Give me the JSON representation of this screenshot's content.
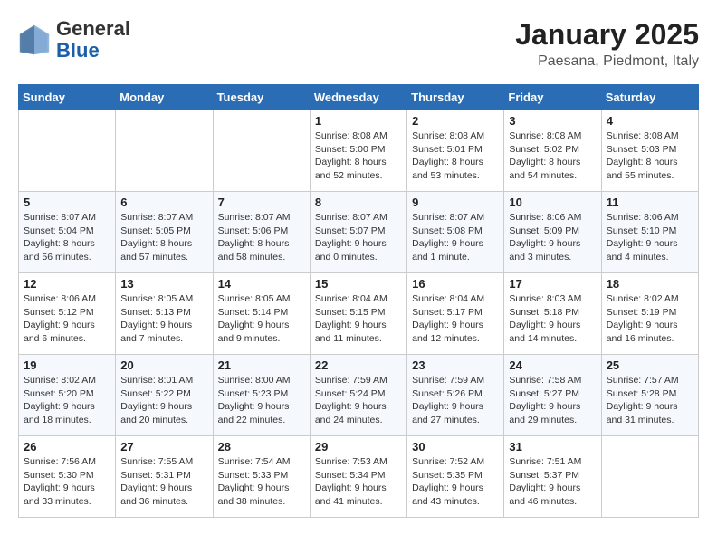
{
  "header": {
    "logo_general": "General",
    "logo_blue": "Blue",
    "month_year": "January 2025",
    "location": "Paesana, Piedmont, Italy"
  },
  "weekdays": [
    "Sunday",
    "Monday",
    "Tuesday",
    "Wednesday",
    "Thursday",
    "Friday",
    "Saturday"
  ],
  "weeks": [
    [
      {
        "day": "",
        "info": ""
      },
      {
        "day": "",
        "info": ""
      },
      {
        "day": "",
        "info": ""
      },
      {
        "day": "1",
        "info": "Sunrise: 8:08 AM\nSunset: 5:00 PM\nDaylight: 8 hours\nand 52 minutes."
      },
      {
        "day": "2",
        "info": "Sunrise: 8:08 AM\nSunset: 5:01 PM\nDaylight: 8 hours\nand 53 minutes."
      },
      {
        "day": "3",
        "info": "Sunrise: 8:08 AM\nSunset: 5:02 PM\nDaylight: 8 hours\nand 54 minutes."
      },
      {
        "day": "4",
        "info": "Sunrise: 8:08 AM\nSunset: 5:03 PM\nDaylight: 8 hours\nand 55 minutes."
      }
    ],
    [
      {
        "day": "5",
        "info": "Sunrise: 8:07 AM\nSunset: 5:04 PM\nDaylight: 8 hours\nand 56 minutes."
      },
      {
        "day": "6",
        "info": "Sunrise: 8:07 AM\nSunset: 5:05 PM\nDaylight: 8 hours\nand 57 minutes."
      },
      {
        "day": "7",
        "info": "Sunrise: 8:07 AM\nSunset: 5:06 PM\nDaylight: 8 hours\nand 58 minutes."
      },
      {
        "day": "8",
        "info": "Sunrise: 8:07 AM\nSunset: 5:07 PM\nDaylight: 9 hours\nand 0 minutes."
      },
      {
        "day": "9",
        "info": "Sunrise: 8:07 AM\nSunset: 5:08 PM\nDaylight: 9 hours\nand 1 minute."
      },
      {
        "day": "10",
        "info": "Sunrise: 8:06 AM\nSunset: 5:09 PM\nDaylight: 9 hours\nand 3 minutes."
      },
      {
        "day": "11",
        "info": "Sunrise: 8:06 AM\nSunset: 5:10 PM\nDaylight: 9 hours\nand 4 minutes."
      }
    ],
    [
      {
        "day": "12",
        "info": "Sunrise: 8:06 AM\nSunset: 5:12 PM\nDaylight: 9 hours\nand 6 minutes."
      },
      {
        "day": "13",
        "info": "Sunrise: 8:05 AM\nSunset: 5:13 PM\nDaylight: 9 hours\nand 7 minutes."
      },
      {
        "day": "14",
        "info": "Sunrise: 8:05 AM\nSunset: 5:14 PM\nDaylight: 9 hours\nand 9 minutes."
      },
      {
        "day": "15",
        "info": "Sunrise: 8:04 AM\nSunset: 5:15 PM\nDaylight: 9 hours\nand 11 minutes."
      },
      {
        "day": "16",
        "info": "Sunrise: 8:04 AM\nSunset: 5:17 PM\nDaylight: 9 hours\nand 12 minutes."
      },
      {
        "day": "17",
        "info": "Sunrise: 8:03 AM\nSunset: 5:18 PM\nDaylight: 9 hours\nand 14 minutes."
      },
      {
        "day": "18",
        "info": "Sunrise: 8:02 AM\nSunset: 5:19 PM\nDaylight: 9 hours\nand 16 minutes."
      }
    ],
    [
      {
        "day": "19",
        "info": "Sunrise: 8:02 AM\nSunset: 5:20 PM\nDaylight: 9 hours\nand 18 minutes."
      },
      {
        "day": "20",
        "info": "Sunrise: 8:01 AM\nSunset: 5:22 PM\nDaylight: 9 hours\nand 20 minutes."
      },
      {
        "day": "21",
        "info": "Sunrise: 8:00 AM\nSunset: 5:23 PM\nDaylight: 9 hours\nand 22 minutes."
      },
      {
        "day": "22",
        "info": "Sunrise: 7:59 AM\nSunset: 5:24 PM\nDaylight: 9 hours\nand 24 minutes."
      },
      {
        "day": "23",
        "info": "Sunrise: 7:59 AM\nSunset: 5:26 PM\nDaylight: 9 hours\nand 27 minutes."
      },
      {
        "day": "24",
        "info": "Sunrise: 7:58 AM\nSunset: 5:27 PM\nDaylight: 9 hours\nand 29 minutes."
      },
      {
        "day": "25",
        "info": "Sunrise: 7:57 AM\nSunset: 5:28 PM\nDaylight: 9 hours\nand 31 minutes."
      }
    ],
    [
      {
        "day": "26",
        "info": "Sunrise: 7:56 AM\nSunset: 5:30 PM\nDaylight: 9 hours\nand 33 minutes."
      },
      {
        "day": "27",
        "info": "Sunrise: 7:55 AM\nSunset: 5:31 PM\nDaylight: 9 hours\nand 36 minutes."
      },
      {
        "day": "28",
        "info": "Sunrise: 7:54 AM\nSunset: 5:33 PM\nDaylight: 9 hours\nand 38 minutes."
      },
      {
        "day": "29",
        "info": "Sunrise: 7:53 AM\nSunset: 5:34 PM\nDaylight: 9 hours\nand 41 minutes."
      },
      {
        "day": "30",
        "info": "Sunrise: 7:52 AM\nSunset: 5:35 PM\nDaylight: 9 hours\nand 43 minutes."
      },
      {
        "day": "31",
        "info": "Sunrise: 7:51 AM\nSunset: 5:37 PM\nDaylight: 9 hours\nand 46 minutes."
      },
      {
        "day": "",
        "info": ""
      }
    ]
  ]
}
